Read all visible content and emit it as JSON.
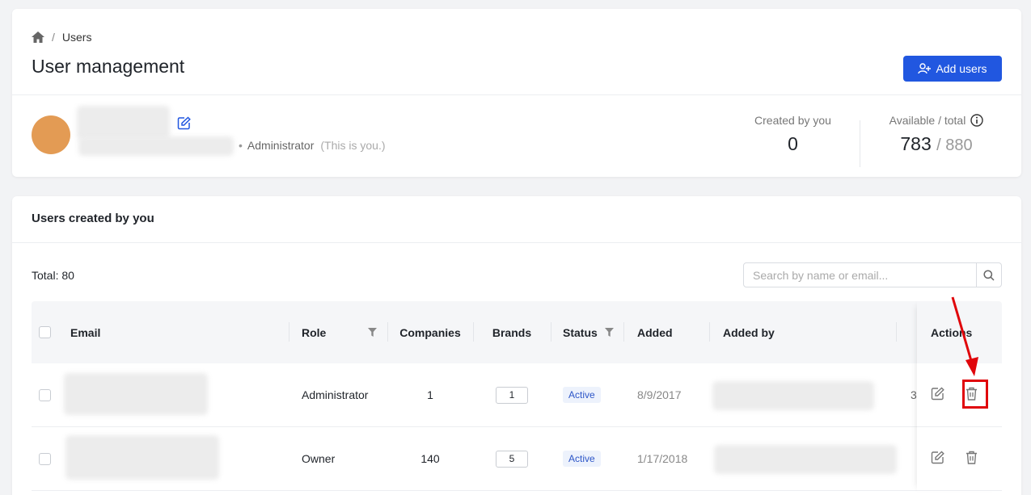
{
  "breadcrumb": {
    "current": "Users"
  },
  "header": {
    "title": "User management",
    "add_button_label": "Add users"
  },
  "profile": {
    "role": "Administrator",
    "self_note": "(This is you.)"
  },
  "stats": {
    "created_label": "Created by you",
    "created_value": "0",
    "available_label": "Available / total",
    "available_value": "783",
    "total_value": "/ 880"
  },
  "section": {
    "title": "Users created by you",
    "total_label": "Total:",
    "total_value": "80"
  },
  "search": {
    "placeholder": "Search by name or email..."
  },
  "table": {
    "columns": {
      "email": "Email",
      "role": "Role",
      "companies": "Companies",
      "brands": "Brands",
      "status": "Status",
      "added": "Added",
      "added_by": "Added by",
      "actions": "Actions"
    },
    "rows": [
      {
        "role": "Administrator",
        "companies": "1",
        "brands": "1",
        "status": "Active",
        "added": "8/9/2017",
        "extra": "3"
      },
      {
        "role": "Owner",
        "companies": "140",
        "brands": "5",
        "status": "Active",
        "added": "1/17/2018"
      }
    ]
  },
  "colors": {
    "accent": "#2157e0",
    "highlight": "#e0060b",
    "avatar": "#e39b54"
  },
  "icons": [
    "home-icon",
    "add-user-icon",
    "edit-icon",
    "info-icon",
    "search-icon",
    "filter-icon",
    "trash-icon"
  ]
}
